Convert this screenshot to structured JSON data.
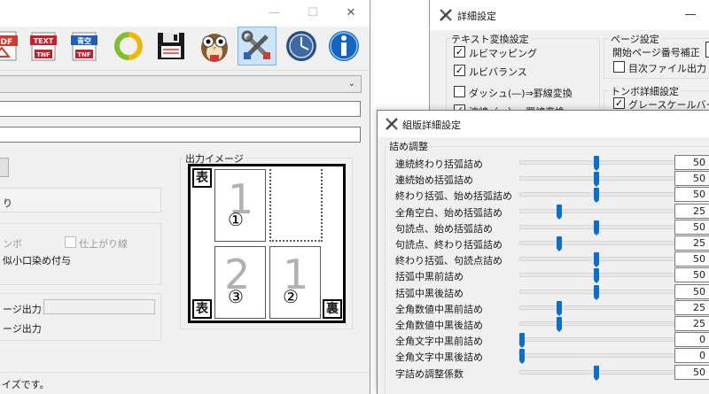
{
  "main_window": {
    "output_image_label": "出力イメージ",
    "side_front": "表",
    "side_back": "裏",
    "page_numbers": [
      "1",
      "2",
      "1"
    ],
    "circled_numbers": [
      "①",
      "③",
      "②"
    ],
    "partial_text_ri": "り",
    "partial_text_tombo": "ンボ",
    "partial_text_koguchi": "似小口染め付与",
    "finish_line_label": "仕上がり線",
    "page_output_1": "ージ出力",
    "page_output_2": "ージ出力",
    "status_text": "イズです。"
  },
  "detail_window": {
    "title": "詳細設定",
    "text_convert_group": "テキスト変換設定",
    "ruby_mapping": "ルビマッピング",
    "ruby_balance": "ルビバランス",
    "dash_convert": "ダッシュ(―)⇒罫線変換",
    "wave_convert_partial": "波線（～）⇒罫線変換",
    "page_settings_group": "ページ設定",
    "start_page_correction": "開始ページ番号補正",
    "toc_file_output": "目次ファイル出力",
    "tombo_group": "トンボ詳細設定",
    "grayscale": "グレースケールバー"
  },
  "kumihan_window": {
    "title": "組版詳細設定",
    "group_title": "詰め調整",
    "rows": [
      {
        "label": "連続終わり括弧詰め",
        "value": "50",
        "pos": 0.5
      },
      {
        "label": "連続始め括弧詰め",
        "value": "50",
        "pos": 0.5
      },
      {
        "label": "終わり括弧、始め括弧詰め",
        "value": "50",
        "pos": 0.5
      },
      {
        "label": "全角空白、始め括弧詰め",
        "value": "25",
        "pos": 0.25
      },
      {
        "label": "句読点、始め括弧詰め",
        "value": "50",
        "pos": 0.5
      },
      {
        "label": "句読点、終わり括弧詰め",
        "value": "25",
        "pos": 0.25
      },
      {
        "label": "終わり括弧、句読点詰め",
        "value": "50",
        "pos": 0.5
      },
      {
        "label": "括弧中黒前詰め",
        "value": "50",
        "pos": 0.5
      },
      {
        "label": "括弧中黒後詰め",
        "value": "50",
        "pos": 0.5
      },
      {
        "label": "全角数値中黒前詰め",
        "value": "25",
        "pos": 0.25
      },
      {
        "label": "全角数値中黒後詰め",
        "value": "25",
        "pos": 0.25
      },
      {
        "label": "全角文字中黒前詰め",
        "value": "0",
        "pos": 0
      },
      {
        "label": "全角文字中黒後詰め",
        "value": "0",
        "pos": 0
      },
      {
        "label": "字詰め調整係数",
        "value": "50",
        "pos": 0.5
      }
    ]
  },
  "colors": {
    "accent": "#0b6ecf",
    "window_bg": "#f0f0f0"
  },
  "icons": [
    "pdf-icon",
    "text-tnf-icon",
    "aozora-tnf-icon",
    "refresh-icon",
    "save-icon",
    "owl-icon",
    "tools-icon",
    "clock-icon",
    "info-icon"
  ]
}
